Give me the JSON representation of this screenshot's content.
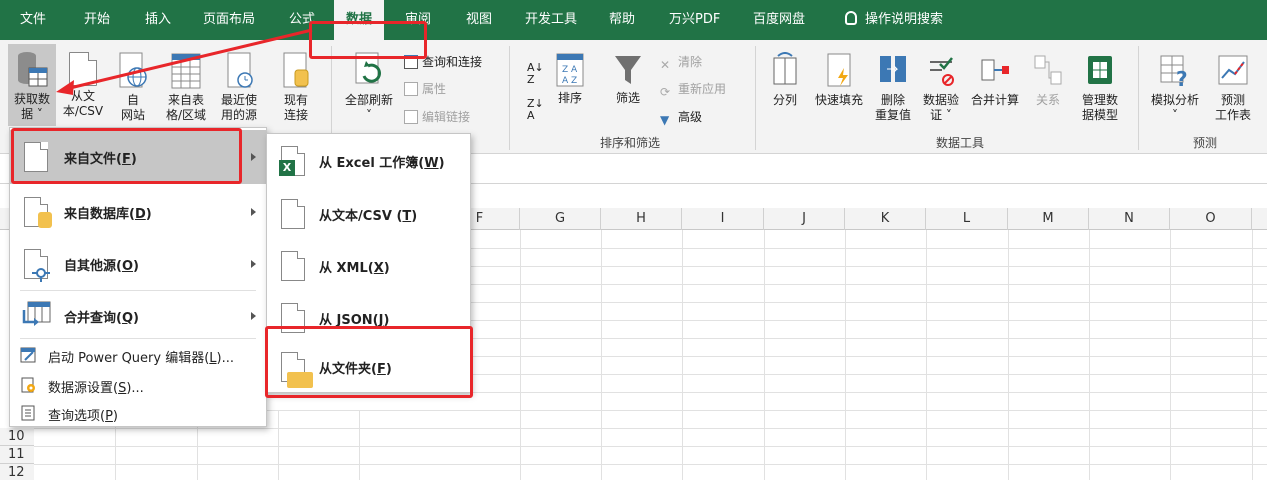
{
  "tabs": [
    "文件",
    "开始",
    "插入",
    "页面布局",
    "公式",
    "数据",
    "审阅",
    "视图",
    "开发工具",
    "帮助",
    "万兴PDF",
    "百度网盘"
  ],
  "active_tab": "数据",
  "tell_me": "操作说明搜索",
  "ribbon": {
    "get_data": {
      "line1": "获取数",
      "line2": "据 ˅"
    },
    "from_text_csv": {
      "line1": "从文",
      "line2": "本/CSV"
    },
    "from_web": {
      "line1": "自",
      "line2": "网站"
    },
    "from_table": {
      "line1": "来自表",
      "line2": "格/区域"
    },
    "recent_sources": {
      "line1": "最近使",
      "line2": "用的源"
    },
    "existing_conn": {
      "line1": "现有",
      "line2": "连接"
    },
    "refresh_all": {
      "line1": "全部刷新",
      "line2": "˅"
    },
    "queries_conn": "查询和连接",
    "properties": "属性",
    "edit_links": "编辑链接",
    "sort_label": "排序",
    "filter_label": "筛选",
    "clear": "清除",
    "reapply": "重新应用",
    "advanced": "高级",
    "sort_filter_group": "排序和筛选",
    "text_to_columns": "分列",
    "flash_fill": "快速填充",
    "remove_dup": {
      "line1": "删除",
      "line2": "重复值"
    },
    "data_validation": {
      "line1": "数据验",
      "line2": "证 ˅"
    },
    "consolidate": "合并计算",
    "relations": "关系",
    "data_model": {
      "line1": "管理数",
      "line2": "据模型"
    },
    "data_tools_group": "数据工具",
    "what_if": {
      "line1": "模拟分析",
      "line2": "˅"
    },
    "forecast": {
      "line1": "预测",
      "line2": "工作表"
    },
    "forecast_group": "预测"
  },
  "columns": [
    "F",
    "G",
    "H",
    "I",
    "J",
    "K",
    "L",
    "M",
    "N",
    "O"
  ],
  "rows": [
    "10",
    "11",
    "12"
  ],
  "menu_primary": {
    "from_file": {
      "text": "来自文件(",
      "key": "F",
      "tail": ")"
    },
    "from_database": {
      "text": "来自数据库(",
      "key": "D",
      "tail": ")"
    },
    "from_other": {
      "text": "自其他源(",
      "key": "O",
      "tail": ")"
    },
    "combine": {
      "text": "合并查询(",
      "key": "Q",
      "tail": ")"
    },
    "launch_pq": {
      "text": "启动 Power Query 编辑器(",
      "key": "L",
      "tail": ")..."
    },
    "ds_settings": {
      "text": "数据源设置(",
      "key": "S",
      "tail": ")..."
    },
    "query_options": {
      "text": "查询选项(",
      "key": "P",
      "tail": ")"
    }
  },
  "menu_file": {
    "from_workbook": {
      "text": "从 Excel 工作簿(",
      "key": "W",
      "tail": ")"
    },
    "from_text": {
      "text": "从文本/CSV (",
      "key": "T",
      "tail": ")"
    },
    "from_xml": {
      "text": "从 XML(",
      "key": "X",
      "tail": ")"
    },
    "from_json": {
      "text": "从 JSON(",
      "key": "J",
      "tail": ")"
    },
    "from_folder": {
      "text": "从文件夹(",
      "key": "F",
      "tail": ")"
    }
  },
  "colors": {
    "excel_green": "#217346",
    "highlight": "#e8262a"
  }
}
